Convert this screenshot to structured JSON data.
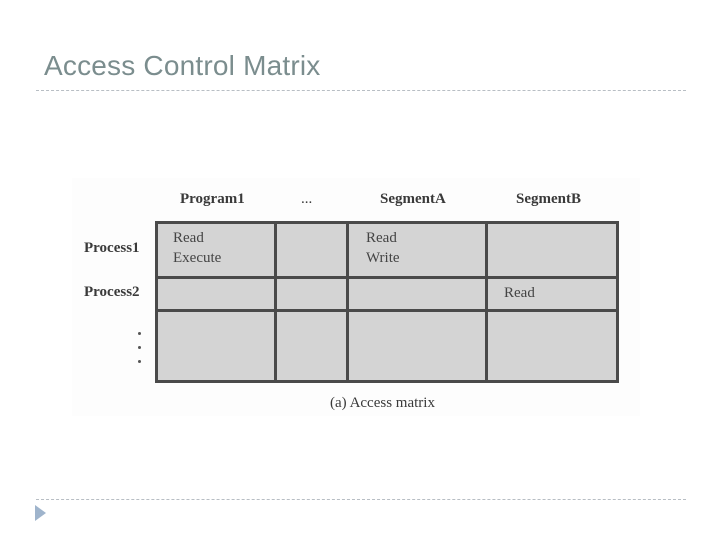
{
  "slide": {
    "title": "Access Control Matrix"
  },
  "figure": {
    "column_headers": [
      "Program1",
      "...",
      "SegmentA",
      "SegmentB"
    ],
    "row_headers": [
      "Process1",
      "Process2"
    ],
    "row_ellipsis": "⋮",
    "cells": {
      "process1_program1": [
        "Read",
        "Execute"
      ],
      "process1_segmentA": [
        "Read",
        "Write"
      ],
      "process2_segmentB": [
        "Read"
      ]
    },
    "caption": "(a) Access matrix"
  },
  "colors": {
    "title": "#7b8d8e",
    "grid_fill": "#d4d4d4",
    "grid_line": "#4a4a4a",
    "bullet": "#9fb4cc"
  }
}
